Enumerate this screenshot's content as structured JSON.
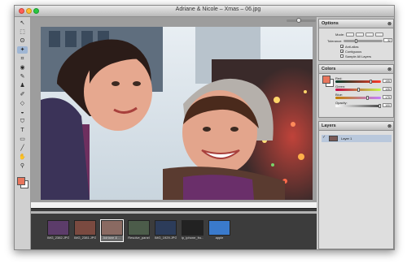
{
  "window": {
    "title": "Adriane & Nicole – Xmas – 06.jpg"
  },
  "tools": [
    {
      "icon": "arrow-tool-icon",
      "glyph": "↖"
    },
    {
      "icon": "marquee-tool-icon",
      "glyph": "⬚"
    },
    {
      "icon": "lasso-tool-icon",
      "glyph": "ʘ"
    },
    {
      "icon": "magic-wand-icon",
      "glyph": "✦"
    },
    {
      "icon": "crop-tool-icon",
      "glyph": "⌗"
    },
    {
      "icon": "red-eye-tool-icon",
      "glyph": "◉"
    },
    {
      "icon": "pencil-tool-icon",
      "glyph": "✎"
    },
    {
      "icon": "stamp-tool-icon",
      "glyph": "♟"
    },
    {
      "icon": "brush-tool-icon",
      "glyph": "✐"
    },
    {
      "icon": "eraser-tool-icon",
      "glyph": "◇"
    },
    {
      "icon": "dodge-tool-icon",
      "glyph": "◒"
    },
    {
      "icon": "bucket-tool-icon",
      "glyph": "⛉"
    },
    {
      "icon": "text-tool-icon",
      "glyph": "T"
    },
    {
      "icon": "shape-tool-icon",
      "glyph": "▭"
    },
    {
      "icon": "eyedropper-tool-icon",
      "glyph": "╱"
    },
    {
      "icon": "hand-tool-icon",
      "glyph": "✋"
    },
    {
      "icon": "zoom-tool-icon",
      "glyph": "⚲"
    }
  ],
  "colors": {
    "foreground": "#e8755c",
    "background": "#ffffff",
    "selection": "#9fb6d4"
  },
  "filmstrip": [
    {
      "caption": "IMG_2382.JPG",
      "color": "#5c3c6a",
      "active": false
    },
    {
      "caption": "IMG_2381.JPG",
      "color": "#7a4a40",
      "active": false
    },
    {
      "caption": "Adriane & ...",
      "color": "#8a6a62",
      "active": true
    },
    {
      "caption": "Resolve_panel",
      "color": "#4c5c4a",
      "active": false
    },
    {
      "caption": "IMG_1929.JPG",
      "color": "#2c3c5a",
      "active": false
    },
    {
      "caption": "ip_iphone_fro...",
      "color": "#222222",
      "active": false
    },
    {
      "caption": "apple",
      "color": "#3a7acc",
      "active": false
    }
  ],
  "options": {
    "title": "Options",
    "mode_label": "Mode:",
    "tolerance_label": "Tolerance:",
    "tolerance_value": "32",
    "anti_alias": "Anti-alias",
    "contiguous": "Contiguous",
    "sample_all": "Sample All Layers"
  },
  "colors_panel": {
    "title": "Colors",
    "red_label": "Red:",
    "red_value": "195",
    "green_label": "Green:",
    "green_value": "126",
    "blue_label": "Blue:",
    "blue_value": "179",
    "opacity_label": "Opacity:",
    "opacity_value": "100"
  },
  "layers": {
    "title": "Layers",
    "items": [
      {
        "name": "Layer 1"
      }
    ]
  }
}
